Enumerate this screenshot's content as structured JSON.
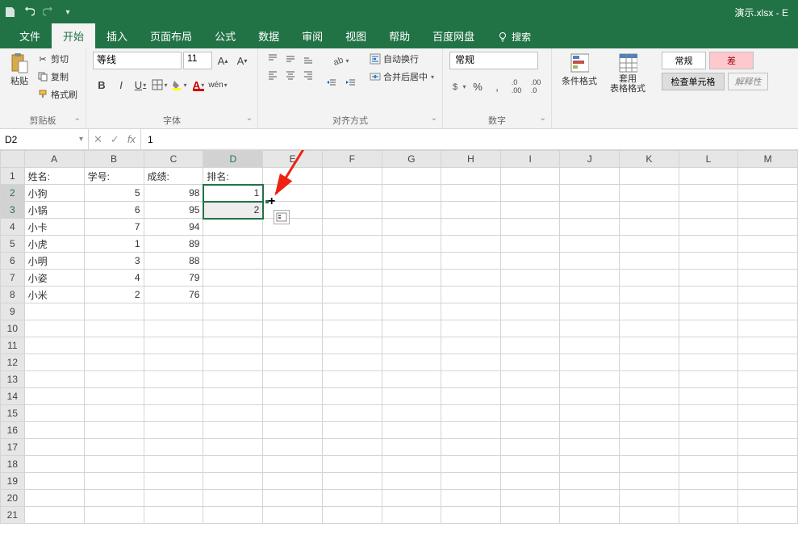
{
  "titlebar": {
    "filename": "演示.xlsx - E"
  },
  "tabs": {
    "file": "文件",
    "home": "开始",
    "insert": "插入",
    "layout": "页面布局",
    "formulas": "公式",
    "data": "数据",
    "review": "审阅",
    "view": "视图",
    "help": "帮助",
    "baidu": "百度网盘",
    "search": "搜索"
  },
  "ribbon": {
    "clipboard": {
      "paste": "粘贴",
      "cut": "剪切",
      "copy": "复制",
      "format_painter": "格式刷",
      "group": "剪贴板"
    },
    "font": {
      "name": "等线",
      "size": "11",
      "group": "字体"
    },
    "alignment": {
      "wrap": "自动换行",
      "merge": "合并后居中",
      "group": "对齐方式"
    },
    "number": {
      "format": "常规",
      "group": "数字"
    },
    "styles": {
      "conditional": "条件格式",
      "table": "套用\n表格格式",
      "normal": "常规",
      "bad": "差",
      "check": "检查单元格",
      "explain": "解释性"
    }
  },
  "formula_bar": {
    "name_box": "D2",
    "formula": "1"
  },
  "columns": [
    "A",
    "B",
    "C",
    "D",
    "E",
    "F",
    "G",
    "H",
    "I",
    "J",
    "K",
    "L",
    "M"
  ],
  "rows_visible": 21,
  "headers": {
    "A": "姓名:",
    "B": "学号:",
    "C": "成绩:",
    "D": "排名:"
  },
  "data": [
    {
      "A": "小狗",
      "B": 5,
      "C": 98,
      "D": 1
    },
    {
      "A": "小锅",
      "B": 6,
      "C": 95,
      "D": 2
    },
    {
      "A": "小卡",
      "B": 7,
      "C": 94
    },
    {
      "A": "小虎",
      "B": 1,
      "C": 89
    },
    {
      "A": "小明",
      "B": 3,
      "C": 88
    },
    {
      "A": "小姿",
      "B": 4,
      "C": 79
    },
    {
      "A": "小米",
      "B": 2,
      "C": 76
    }
  ],
  "selection": {
    "active": "D2",
    "range_end": "D3"
  }
}
